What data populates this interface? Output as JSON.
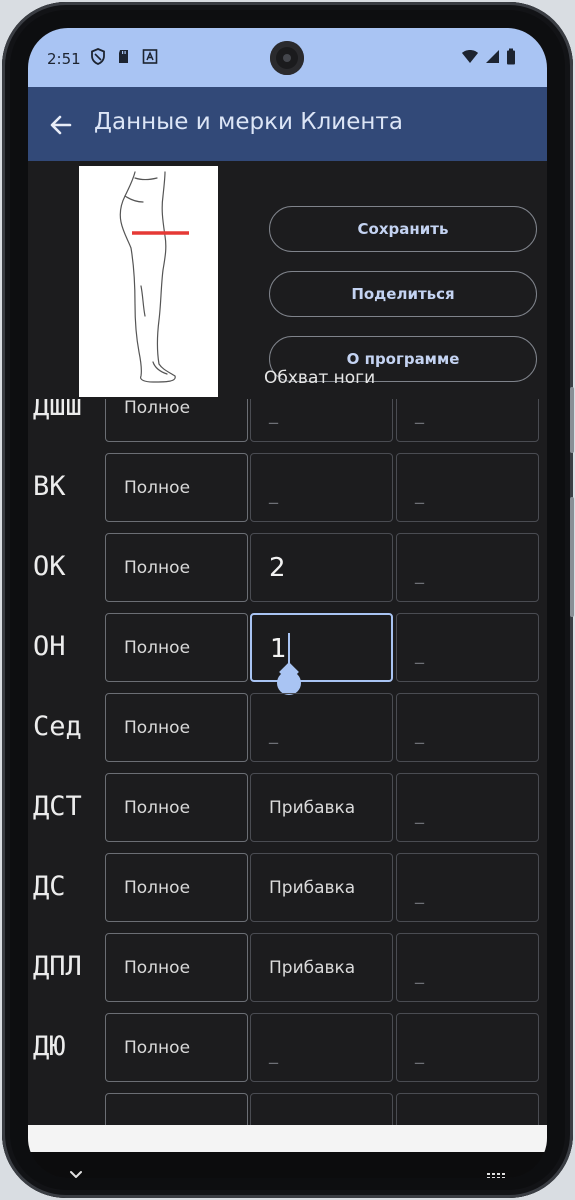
{
  "status_bar": {
    "time": "2:51",
    "icons": [
      "shield-icon",
      "sd-card-icon",
      "font-a-icon",
      "wifi-icon",
      "cellular-signal-icon",
      "battery-icon"
    ]
  },
  "app_bar": {
    "title": "Данные и мерки Клиента",
    "back_icon": "arrow-left-icon"
  },
  "buttons": {
    "save": "Сохранить",
    "share": "Поделиться",
    "about": "О программе"
  },
  "figure": {
    "caption": "Обхват ноги",
    "highlight_color": "#e53935"
  },
  "rows": [
    {
      "label": "ДШШ",
      "col1": "Полное",
      "col2": "_",
      "col3": "_"
    },
    {
      "label": "ВК",
      "col1": "Полное",
      "col2": "_",
      "col3": "_"
    },
    {
      "label": "ОК",
      "col1": "Полное",
      "col2": "2",
      "col3": "_"
    },
    {
      "label": "ОН",
      "col1": "Полное",
      "col2": "1",
      "col3": "_"
    },
    {
      "label": "Сед",
      "col1": "Полное",
      "col2": "_",
      "col3": "_"
    },
    {
      "label": "ДСТ",
      "col1": "Полное",
      "col2": "Прибавка",
      "col3": "_"
    },
    {
      "label": "ДС",
      "col1": "Полное",
      "col2": "Прибавка",
      "col3": "_"
    },
    {
      "label": "ДПЛ",
      "col1": "Полное",
      "col2": "Прибавка",
      "col3": "_"
    },
    {
      "label": "ДЮ",
      "col1": "Полное",
      "col2": "_",
      "col3": "_"
    }
  ],
  "colors": {
    "status_bar": "#a9c4f3",
    "app_bar": "#324978",
    "background": "#1c1c1e",
    "accent": "#a9c4f3"
  },
  "nav_bar": {
    "icons": [
      "chevron-down-icon",
      "keyboard-icon"
    ]
  }
}
